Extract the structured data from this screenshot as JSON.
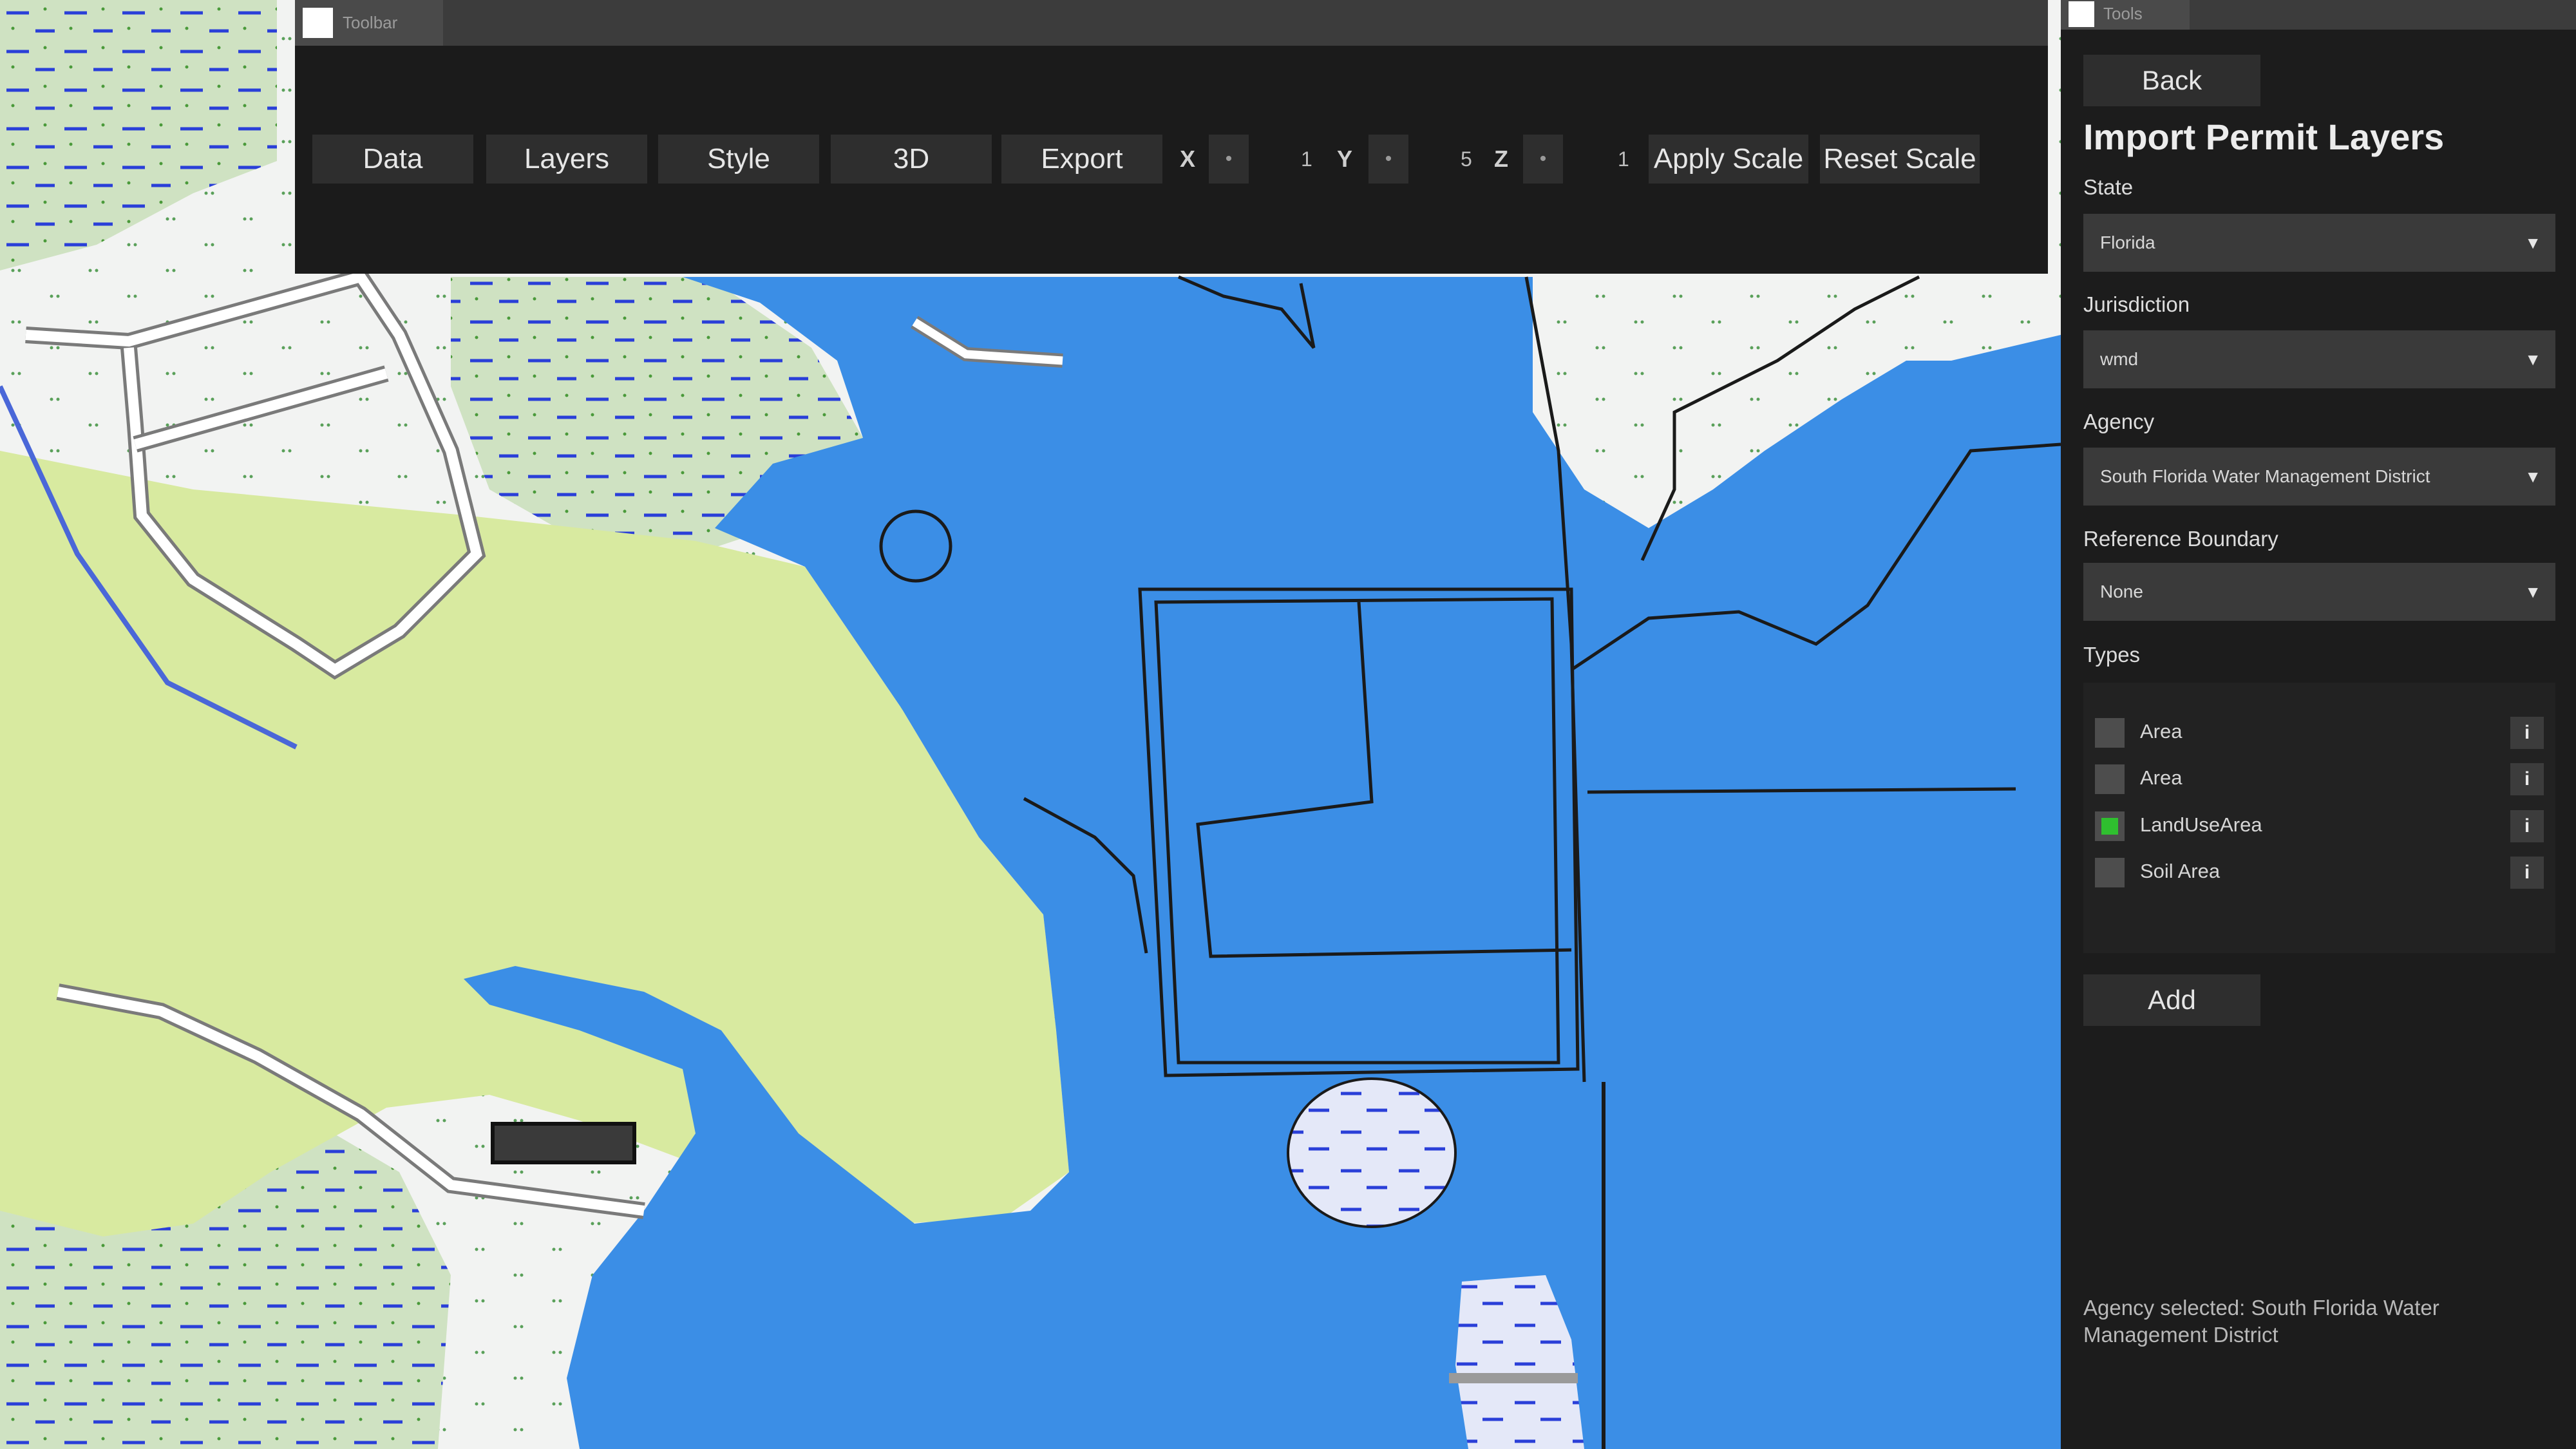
{
  "colors": {
    "water": "#3b8ee6",
    "land_green": "#d8eaa0",
    "wetland": "#cfe2c2",
    "background": "#f2f3f2",
    "panel": "#1c1c1c",
    "checked": "#2fbf2f"
  },
  "toolbar": {
    "window_title": "Toolbar",
    "buttons": [
      "Data",
      "Layers",
      "Style",
      "3D",
      "Export"
    ],
    "scale": {
      "x_label": "X",
      "x_value": "1",
      "y_label": "Y",
      "y_value": "5",
      "z_label": "Z",
      "z_value": "1",
      "step_symbol": "•"
    },
    "apply_scale": "Apply Scale",
    "reset_scale": "Reset Scale"
  },
  "tools": {
    "window_title": "Tools",
    "back": "Back",
    "title": "Import Permit Layers",
    "state_label": "State",
    "state_value": "Florida",
    "jurisdiction_label": "Jurisdiction",
    "jurisdiction_value": "wmd",
    "agency_label": "Agency",
    "agency_value": "South Florida Water Management District",
    "boundary_label": "Reference Boundary",
    "boundary_value": "None",
    "dropdown_arrow": "▼",
    "types_label": "Types",
    "types": [
      {
        "label": "Area",
        "checked": false,
        "info": "i"
      },
      {
        "label": "Area",
        "checked": false,
        "info": "i"
      },
      {
        "label": "LandUseArea",
        "checked": true,
        "info": "i"
      },
      {
        "label": "Soil Area",
        "checked": false,
        "info": "i"
      }
    ],
    "add": "Add",
    "status": "Agency selected: South Florida Water Management District"
  }
}
